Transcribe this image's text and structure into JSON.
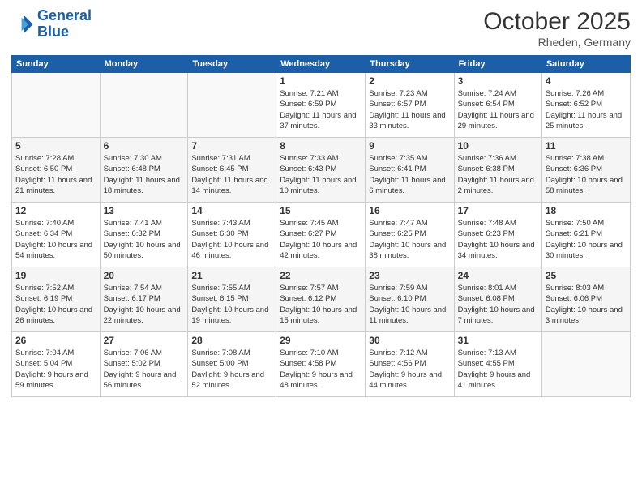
{
  "header": {
    "logo_line1": "General",
    "logo_line2": "Blue",
    "month": "October 2025",
    "location": "Rheden, Germany"
  },
  "days_of_week": [
    "Sunday",
    "Monday",
    "Tuesday",
    "Wednesday",
    "Thursday",
    "Friday",
    "Saturday"
  ],
  "weeks": [
    [
      {
        "day": "",
        "info": ""
      },
      {
        "day": "",
        "info": ""
      },
      {
        "day": "",
        "info": ""
      },
      {
        "day": "1",
        "info": "Sunrise: 7:21 AM\nSunset: 6:59 PM\nDaylight: 11 hours and 37 minutes."
      },
      {
        "day": "2",
        "info": "Sunrise: 7:23 AM\nSunset: 6:57 PM\nDaylight: 11 hours and 33 minutes."
      },
      {
        "day": "3",
        "info": "Sunrise: 7:24 AM\nSunset: 6:54 PM\nDaylight: 11 hours and 29 minutes."
      },
      {
        "day": "4",
        "info": "Sunrise: 7:26 AM\nSunset: 6:52 PM\nDaylight: 11 hours and 25 minutes."
      }
    ],
    [
      {
        "day": "5",
        "info": "Sunrise: 7:28 AM\nSunset: 6:50 PM\nDaylight: 11 hours and 21 minutes."
      },
      {
        "day": "6",
        "info": "Sunrise: 7:30 AM\nSunset: 6:48 PM\nDaylight: 11 hours and 18 minutes."
      },
      {
        "day": "7",
        "info": "Sunrise: 7:31 AM\nSunset: 6:45 PM\nDaylight: 11 hours and 14 minutes."
      },
      {
        "day": "8",
        "info": "Sunrise: 7:33 AM\nSunset: 6:43 PM\nDaylight: 11 hours and 10 minutes."
      },
      {
        "day": "9",
        "info": "Sunrise: 7:35 AM\nSunset: 6:41 PM\nDaylight: 11 hours and 6 minutes."
      },
      {
        "day": "10",
        "info": "Sunrise: 7:36 AM\nSunset: 6:38 PM\nDaylight: 11 hours and 2 minutes."
      },
      {
        "day": "11",
        "info": "Sunrise: 7:38 AM\nSunset: 6:36 PM\nDaylight: 10 hours and 58 minutes."
      }
    ],
    [
      {
        "day": "12",
        "info": "Sunrise: 7:40 AM\nSunset: 6:34 PM\nDaylight: 10 hours and 54 minutes."
      },
      {
        "day": "13",
        "info": "Sunrise: 7:41 AM\nSunset: 6:32 PM\nDaylight: 10 hours and 50 minutes."
      },
      {
        "day": "14",
        "info": "Sunrise: 7:43 AM\nSunset: 6:30 PM\nDaylight: 10 hours and 46 minutes."
      },
      {
        "day": "15",
        "info": "Sunrise: 7:45 AM\nSunset: 6:27 PM\nDaylight: 10 hours and 42 minutes."
      },
      {
        "day": "16",
        "info": "Sunrise: 7:47 AM\nSunset: 6:25 PM\nDaylight: 10 hours and 38 minutes."
      },
      {
        "day": "17",
        "info": "Sunrise: 7:48 AM\nSunset: 6:23 PM\nDaylight: 10 hours and 34 minutes."
      },
      {
        "day": "18",
        "info": "Sunrise: 7:50 AM\nSunset: 6:21 PM\nDaylight: 10 hours and 30 minutes."
      }
    ],
    [
      {
        "day": "19",
        "info": "Sunrise: 7:52 AM\nSunset: 6:19 PM\nDaylight: 10 hours and 26 minutes."
      },
      {
        "day": "20",
        "info": "Sunrise: 7:54 AM\nSunset: 6:17 PM\nDaylight: 10 hours and 22 minutes."
      },
      {
        "day": "21",
        "info": "Sunrise: 7:55 AM\nSunset: 6:15 PM\nDaylight: 10 hours and 19 minutes."
      },
      {
        "day": "22",
        "info": "Sunrise: 7:57 AM\nSunset: 6:12 PM\nDaylight: 10 hours and 15 minutes."
      },
      {
        "day": "23",
        "info": "Sunrise: 7:59 AM\nSunset: 6:10 PM\nDaylight: 10 hours and 11 minutes."
      },
      {
        "day": "24",
        "info": "Sunrise: 8:01 AM\nSunset: 6:08 PM\nDaylight: 10 hours and 7 minutes."
      },
      {
        "day": "25",
        "info": "Sunrise: 8:03 AM\nSunset: 6:06 PM\nDaylight: 10 hours and 3 minutes."
      }
    ],
    [
      {
        "day": "26",
        "info": "Sunrise: 7:04 AM\nSunset: 5:04 PM\nDaylight: 9 hours and 59 minutes."
      },
      {
        "day": "27",
        "info": "Sunrise: 7:06 AM\nSunset: 5:02 PM\nDaylight: 9 hours and 56 minutes."
      },
      {
        "day": "28",
        "info": "Sunrise: 7:08 AM\nSunset: 5:00 PM\nDaylight: 9 hours and 52 minutes."
      },
      {
        "day": "29",
        "info": "Sunrise: 7:10 AM\nSunset: 4:58 PM\nDaylight: 9 hours and 48 minutes."
      },
      {
        "day": "30",
        "info": "Sunrise: 7:12 AM\nSunset: 4:56 PM\nDaylight: 9 hours and 44 minutes."
      },
      {
        "day": "31",
        "info": "Sunrise: 7:13 AM\nSunset: 4:55 PM\nDaylight: 9 hours and 41 minutes."
      },
      {
        "day": "",
        "info": ""
      }
    ]
  ]
}
